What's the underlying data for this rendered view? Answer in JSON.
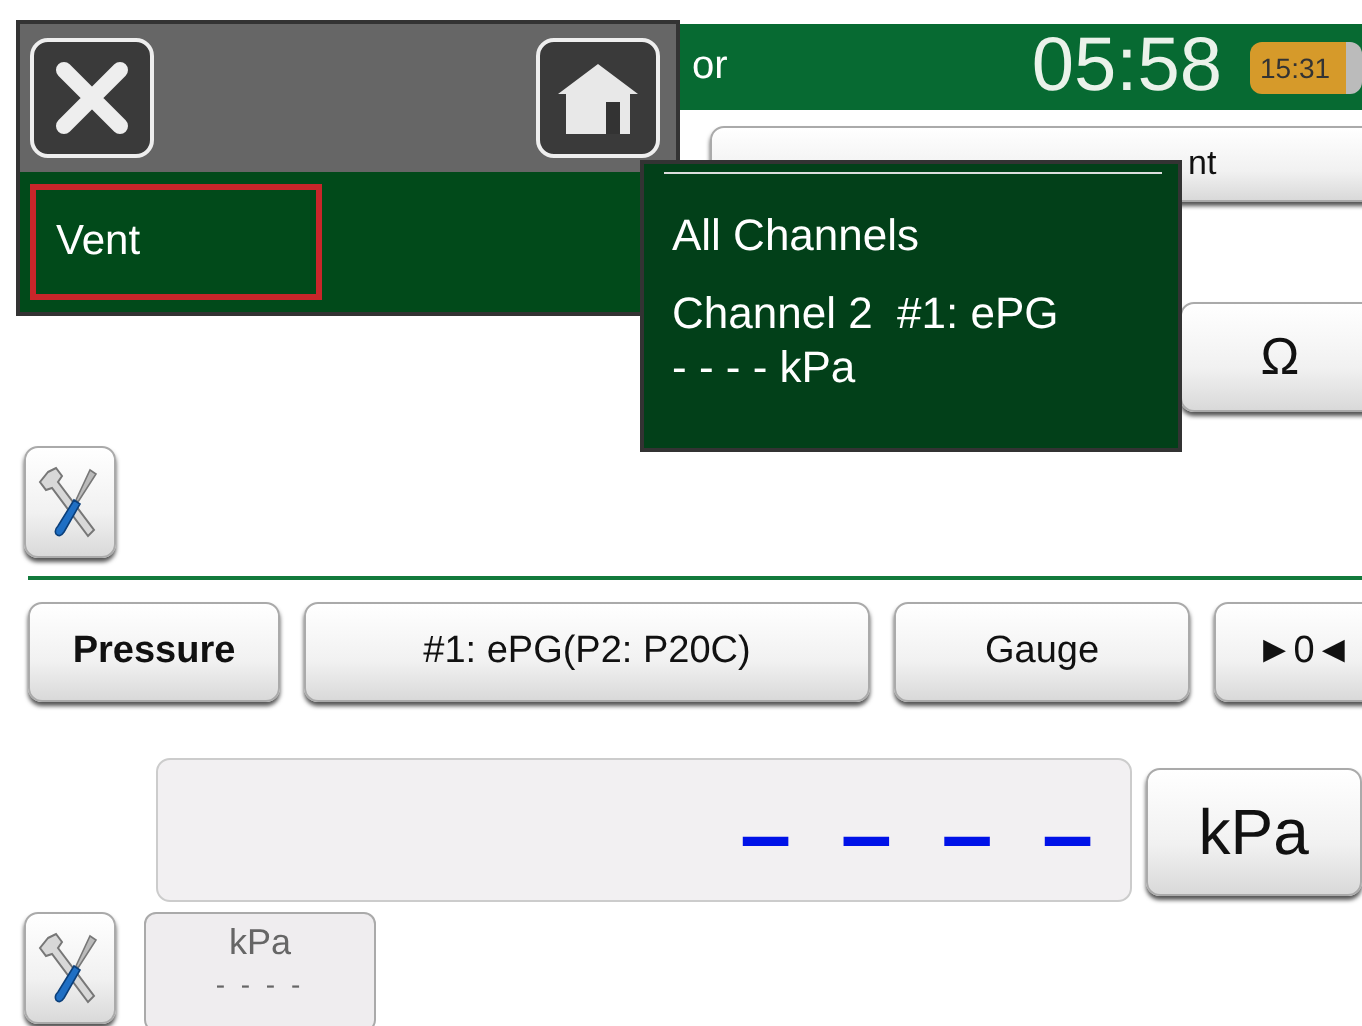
{
  "title_bar": {
    "title": "or",
    "time": "05:58",
    "battery": "15:31"
  },
  "top_button": {
    "label": "nt"
  },
  "unit_button": {
    "label": "Ω"
  },
  "quantity_buttons": [
    {
      "label": "Pressure",
      "bold": true
    },
    {
      "label": "#1: ePG(P2: P20C)",
      "bold": false
    },
    {
      "label": "Gauge",
      "bold": false
    },
    {
      "label": "►0◄",
      "bold": false
    }
  ],
  "reading": {
    "value": "– – – –",
    "unit": "kPa"
  },
  "secondary": {
    "unit": "kPa",
    "value": "- - - -"
  },
  "menu": {
    "items": [
      {
        "label": "Vent",
        "selected": true
      }
    ]
  },
  "popup": {
    "lines": [
      "All Channels",
      "Channel 2  #1: ePG",
      "- - - - kPa"
    ]
  }
}
